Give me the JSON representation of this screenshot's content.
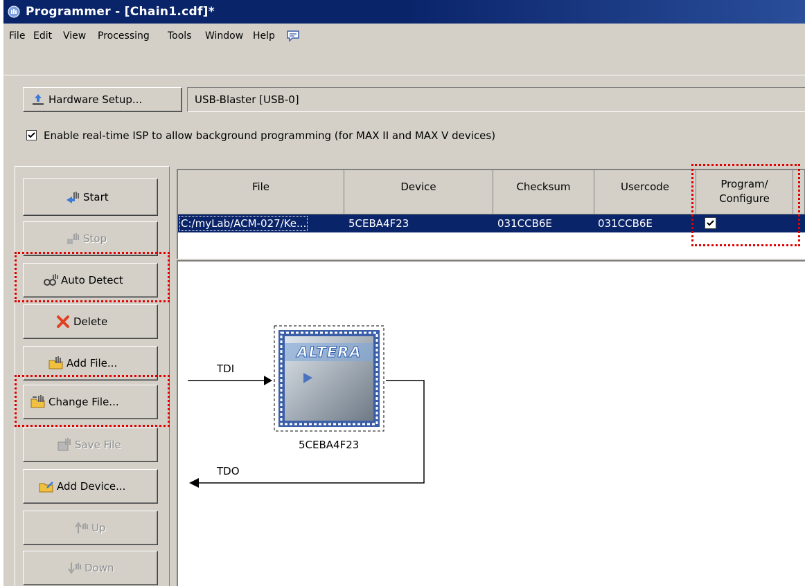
{
  "window": {
    "title": "Programmer - [Chain1.cdf]*"
  },
  "menu": [
    "File",
    "Edit",
    "View",
    "Processing",
    "Tools",
    "Window",
    "Help"
  ],
  "hardware": {
    "setup_label": "Hardware Setup...",
    "current": "USB-Blaster [USB-0]",
    "isp_label": "Enable real-time ISP to allow background programming (for MAX II and MAX V devices)",
    "isp_checked": true
  },
  "sidebar": {
    "buttons": [
      {
        "label": "Start",
        "enabled": true
      },
      {
        "label": "Stop",
        "enabled": false
      },
      {
        "label": "Auto Detect",
        "enabled": true
      },
      {
        "label": "Delete",
        "enabled": true
      },
      {
        "label": "Add File...",
        "enabled": true
      },
      {
        "label": "Change File...",
        "enabled": true
      },
      {
        "label": "Save File",
        "enabled": false
      },
      {
        "label": "Add Device...",
        "enabled": true
      },
      {
        "label": "Up",
        "enabled": false
      },
      {
        "label": "Down",
        "enabled": false
      }
    ]
  },
  "table": {
    "columns": [
      "File",
      "Device",
      "Checksum",
      "Usercode",
      "Program/\nConfigure"
    ],
    "rows": [
      {
        "file": "C:/myLab/ACM-027/Ke...",
        "device": "5CEBA4F23",
        "checksum": "031CCB6E",
        "usercode": "031CCB6E",
        "program": true
      }
    ]
  },
  "chain": {
    "tdi_label": "TDI",
    "tdo_label": "TDO",
    "chip_logo": "ALTERA",
    "chip_name": "5CEBA4F23"
  },
  "colors": {
    "titlebar": "#0a246a",
    "selection": "#0a246a",
    "highlight_box": "#e00000",
    "face": "#d4d0c8"
  }
}
